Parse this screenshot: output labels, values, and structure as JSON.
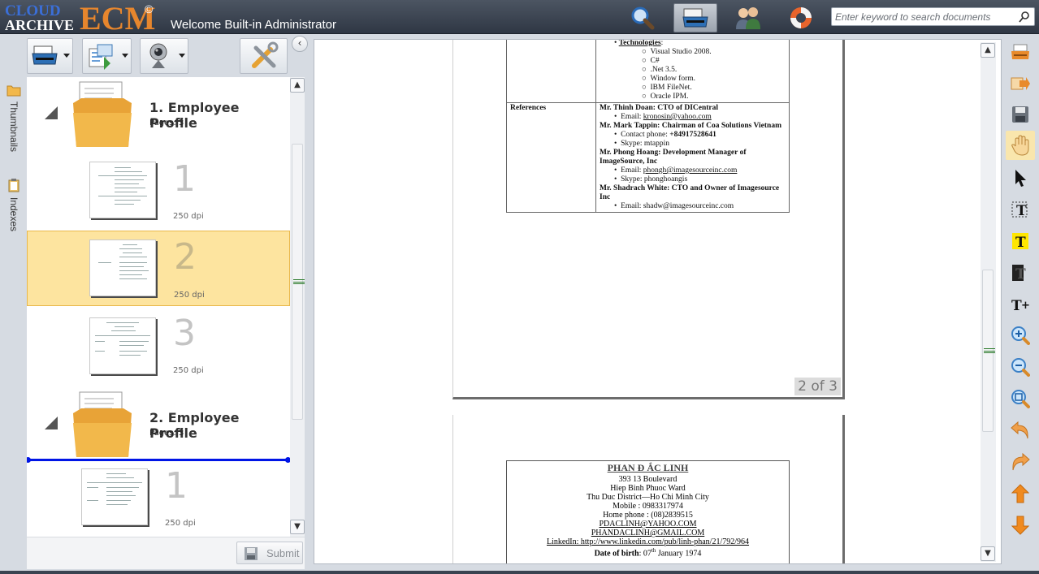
{
  "header": {
    "logo_cloud": "CLOUD",
    "logo_archive": "ARCHIVE",
    "logo_ecm": "ECM",
    "logo_reg": "©",
    "welcome": "Welcome Built-in Administrator",
    "nav_buttons": [
      "search-icon",
      "scanner-icon",
      "users-icon",
      "help-lifebuoy-icon"
    ],
    "search_placeholder": "Enter keyword to search documents"
  },
  "left_rail": {
    "thumbnails_label": "Thumbnails",
    "indexes_label": "Indexes"
  },
  "left_toolbar": {
    "buttons": [
      "scan-icon",
      "import-icon",
      "webcam-icon",
      "settings-tools-icon"
    ],
    "collapse_glyph": "‹"
  },
  "tree": {
    "folders": [
      {
        "title": "1. Employee Profile",
        "pages_label": "Pages: 3",
        "pages": [
          {
            "number": "1",
            "dpi": "250 dpi",
            "selected": false
          },
          {
            "number": "2",
            "dpi": "250 dpi",
            "selected": true
          },
          {
            "number": "3",
            "dpi": "250 dpi",
            "selected": false
          }
        ]
      },
      {
        "title": "2. Employee Profile",
        "pages_label": "Pages: 3",
        "pages": [
          {
            "number": "1",
            "dpi": "250 dpi",
            "selected": false
          }
        ]
      }
    ]
  },
  "submit_label": "Submit",
  "viewer": {
    "page_indicator": "2 of 3",
    "page2": {
      "technologies_heading": "Technologies",
      "technologies_colon": ":",
      "technologies": [
        "Visual Studio 2008.",
        "C#",
        ".Net 3.5.",
        "Window form.",
        "IBM FileNet.",
        "Oracle IPM."
      ],
      "references_label": "References",
      "ref1_name": "Mr. Thinh Doan: CTO of DICentral",
      "ref1_email_label": "Email: ",
      "ref1_email": "kronosin@yahoo.com",
      "ref2_name": "Mr. Mark Tappin: Chairman of Coa Solutions Vietnam",
      "ref2_phone_label": "Contact phone: ",
      "ref2_phone": "+84917528641",
      "ref2_skype": "Skype: mtappin",
      "ref3_name": "Mr. Phong Hoang: Development Manager of ImageSource, Inc",
      "ref3_email_label": "Email: ",
      "ref3_email": "phongh@imagesourceinc.com",
      "ref3_skype": "Skype: phonghoangis",
      "ref4_name": "Mr. Shadrach White: CTO and Owner of Imagesource Inc",
      "ref4_email": "Email: shadw@imagesourceinc.com"
    },
    "page3": {
      "name": "PHAN Đ ẮC LINH",
      "address1": "393 13 Boulevard",
      "address2": "Hiep Binh Phuoc Ward",
      "address3": "Thu Duc District—Ho Chi Minh City",
      "mobile": "Mobile : 0983317974",
      "home_phone": "Home phone : (08)2839515",
      "email1": "PDACLINH@YAHOO.COM",
      "email2": "PHANDACLINH@GMAIL.COM",
      "linkedin": "LinkedIn: http://www.linkedin.com/pub/linh-phan/21/792/964",
      "dob_label": "Date of birth",
      "dob_day": ": 07",
      "dob_sup": "th",
      "dob_rest": " January 1974"
    }
  },
  "right_toolbar": [
    "scan-to-tray-icon",
    "export-arrow-icon",
    "save-disk-icon",
    "pan-hand-icon",
    "select-pointer-icon",
    "text-redact-icon",
    "text-highlight-icon",
    "text-blackout-icon",
    "add-text-icon",
    "zoom-in-icon",
    "zoom-out-icon",
    "fit-zoom-icon",
    "undo-icon",
    "redo-icon",
    "move-up-icon",
    "move-down-icon"
  ]
}
